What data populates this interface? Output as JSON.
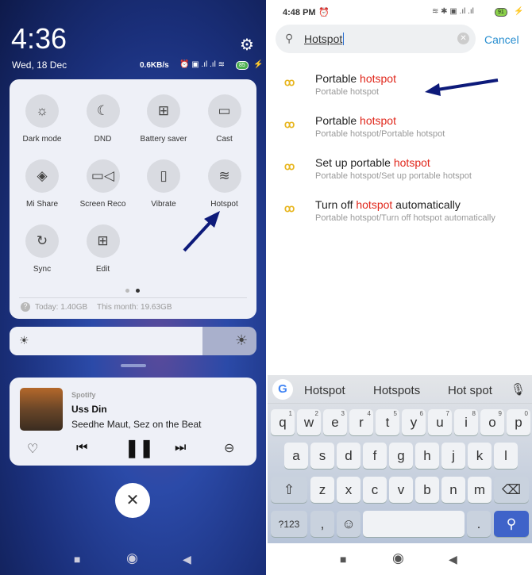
{
  "left": {
    "clock": "4:36",
    "date": "Wed, 18 Dec",
    "net_speed": "0.6KB/s",
    "battery": "85",
    "tiles": [
      {
        "label": "Dark mode",
        "icon": "dark-mode-icon",
        "glyph": "☼"
      },
      {
        "label": "DND",
        "icon": "moon-icon",
        "glyph": "☾"
      },
      {
        "label": "Battery saver",
        "icon": "battery-saver-icon",
        "glyph": "⊞"
      },
      {
        "label": "Cast",
        "icon": "cast-icon",
        "glyph": "▭"
      },
      {
        "label": "Mi Share",
        "icon": "mi-share-icon",
        "glyph": "◈"
      },
      {
        "label": "Screen Reco",
        "icon": "screen-record-icon",
        "glyph": "▭◁"
      },
      {
        "label": "Vibrate",
        "icon": "vibrate-icon",
        "glyph": "▯"
      },
      {
        "label": "Hotspot",
        "icon": "hotspot-icon",
        "glyph": "≋"
      },
      {
        "label": "Sync",
        "icon": "sync-icon",
        "glyph": "↻"
      },
      {
        "label": "Edit",
        "icon": "edit-grid-icon",
        "glyph": "⊞"
      }
    ],
    "data_today": "Today: 1.40GB",
    "data_month": "This month: 19.63GB",
    "brightness_percent": 78,
    "media": {
      "app": "Spotify",
      "title": "Uss Din",
      "artist": "Seedhe Maut, Sez on the Beat"
    }
  },
  "right": {
    "clock": "4:48 PM",
    "battery": "91",
    "search_value": "Hotspot",
    "cancel": "Cancel",
    "results": [
      {
        "pre": "Portable ",
        "hl": "hotspot",
        "post": "",
        "sub": "Portable hotspot"
      },
      {
        "pre": "Portable ",
        "hl": "hotspot",
        "post": "",
        "sub": "Portable hotspot/Portable hotspot"
      },
      {
        "pre": "Set up portable ",
        "hl": "hotspot",
        "post": "",
        "sub": "Portable hotspot/Set up portable hotspot"
      },
      {
        "pre": "Turn off ",
        "hl": "hotspot",
        "post": " automatically",
        "sub": "Portable hotspot/Turn off hotspot automatically"
      }
    ],
    "suggestions": [
      "Hotspot",
      "Hotspots",
      "Hot spot"
    ],
    "row1": [
      "q",
      "w",
      "e",
      "r",
      "t",
      "y",
      "u",
      "i",
      "o",
      "p"
    ],
    "row1_nums": [
      "1",
      "2",
      "3",
      "4",
      "5",
      "6",
      "7",
      "8",
      "9",
      "0"
    ],
    "row2": [
      "a",
      "s",
      "d",
      "f",
      "g",
      "h",
      "j",
      "k",
      "l"
    ],
    "row3": [
      "z",
      "x",
      "c",
      "v",
      "b",
      "n",
      "m"
    ],
    "symbols_key": "?123",
    "comma": ",",
    "period": "."
  },
  "colors": {
    "accent_red": "#e0261a",
    "cancel_blue": "#2a8fd0",
    "search_key": "#3f63c9",
    "arrow": "#0d1a7a"
  }
}
